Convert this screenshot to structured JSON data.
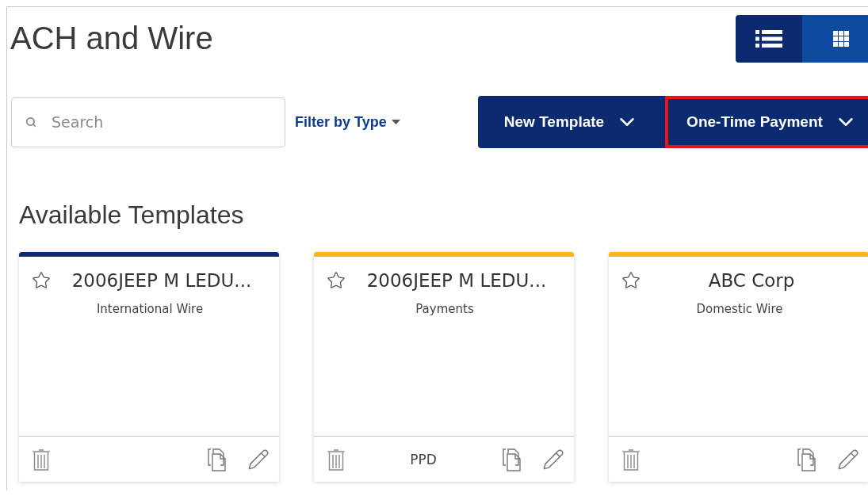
{
  "page": {
    "title": "ACH and Wire"
  },
  "view_toggle": [
    {
      "kind": "list",
      "selected": false
    },
    {
      "kind": "grid",
      "selected": true
    }
  ],
  "search": {
    "placeholder": "Search"
  },
  "filter": {
    "label": "Filter by Type"
  },
  "actions": [
    {
      "label": "New Template",
      "highlighted": false
    },
    {
      "label": "One-Time Payment",
      "highlighted": true
    }
  ],
  "section_title": "Available Templates",
  "templates": [
    {
      "name": "2006JEEP M LEDU...",
      "type": "International Wire",
      "color": "#0b2a6f",
      "favorite": false
    },
    {
      "name": "2006JEEP M LEDU...",
      "type": "Payments",
      "color": "#fbb41a",
      "favorite": false,
      "footer_label": "PPD"
    },
    {
      "name": "ABC Corp",
      "type": "Domestic Wire",
      "color": "#fbb41a",
      "favorite": false
    }
  ]
}
